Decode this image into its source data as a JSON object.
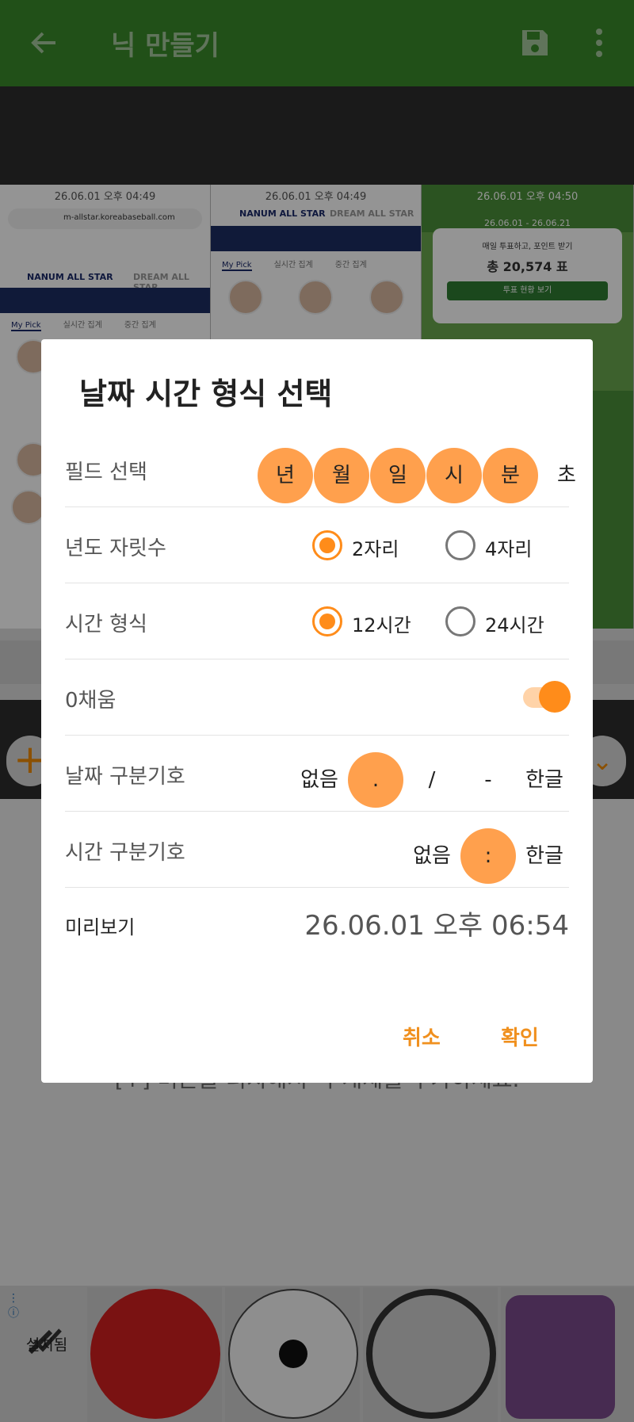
{
  "appbar": {
    "title": "닉 만들기",
    "back_icon": "arrow-left-icon",
    "save_icon": "floppy-disk-icon",
    "more_icon": "more-vertical-icon",
    "color": "#3a8a2a"
  },
  "background": {
    "shots": [
      {
        "time": "26.06.01  오후 04:49",
        "url": "m-allstar.koreabaseball.com",
        "logo_left": "NANUM ALL STAR",
        "logo_right": "DREAM ALL STAR",
        "tabs": [
          "My Pick",
          "실시간 집계",
          "중간 집계"
        ]
      },
      {
        "time": "26.06.01  오후 04:49",
        "logo_left": "NANUM ALL STAR",
        "logo_right": "DREAM ALL STAR",
        "tabs": [
          "My Pick",
          "실시간 집계",
          "중간 집계"
        ]
      },
      {
        "time": "26.06.01  오후 04:50",
        "period": "26.06.01 - 26.06.21",
        "card_title": "매일 투표하고, 포인트 받기",
        "card_total": "총 20,574 표",
        "card_button": "투표 현황 보기"
      }
    ],
    "hint": "[+] 버튼을 터치해서 각 개체를 추가하세요.",
    "tray_installed": "설치됨"
  },
  "dialog": {
    "title": "날짜 시간 형식 선택",
    "field": {
      "label": "필드 선택",
      "options": [
        "년",
        "월",
        "일",
        "시",
        "분",
        "초"
      ]
    },
    "year_digits": {
      "label": "년도 자릿수",
      "options": [
        "2자리",
        "4자리"
      ],
      "selected": "2자리"
    },
    "time_format": {
      "label": "시간 형식",
      "options": [
        "12시간",
        "24시간"
      ],
      "selected": "12시간"
    },
    "zero_fill": {
      "label": "0채움",
      "on": true
    },
    "date_sep": {
      "label": "날짜 구분기호",
      "options": [
        "없음",
        ".",
        "/",
        "-",
        "한글"
      ],
      "selected": "."
    },
    "time_sep": {
      "label": "시간 구분기호",
      "options": [
        "없음",
        ":",
        "한글"
      ],
      "selected": ":"
    },
    "preview": {
      "label": "미리보기",
      "value": "26.06.01  오후 06:54"
    },
    "cancel": "취소",
    "ok": "확인",
    "accent": "#ff8c1a"
  }
}
